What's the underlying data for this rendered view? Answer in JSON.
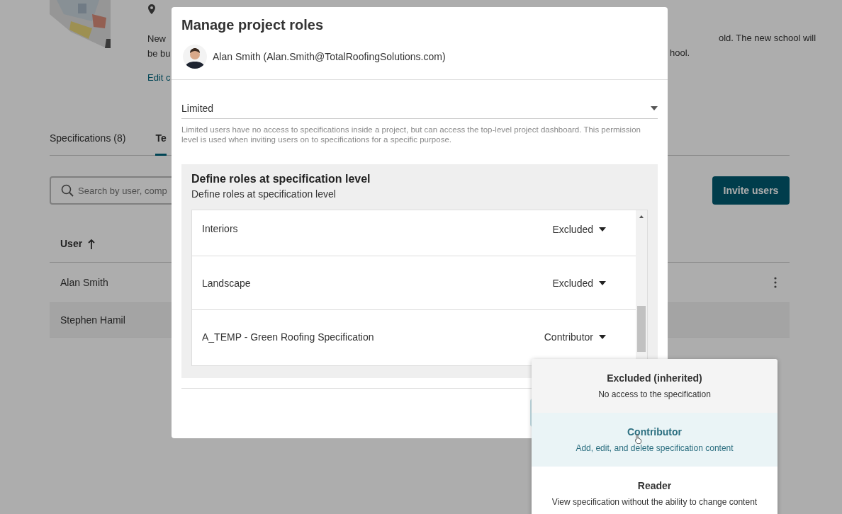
{
  "background": {
    "description_lines": [
      {
        "left": "New",
        "right": "old. The new school will"
      },
      {
        "left": "be bu",
        "right": "hool."
      }
    ],
    "edit_link": "Edit c",
    "tabs": [
      {
        "label": "Specifications (8)",
        "selected": false
      },
      {
        "label": "Te",
        "selected": true
      }
    ],
    "search": {
      "placeholder": "Search by user, comp"
    },
    "invite_button": "Invite users",
    "table": {
      "columns": [
        {
          "label": "User",
          "sorted_ascending": true
        }
      ],
      "rows": [
        {
          "user": "Alan Smith",
          "selected": false
        },
        {
          "user": "Stephen Hamil",
          "selected": true
        }
      ]
    }
  },
  "dialog": {
    "title": "Manage project roles",
    "user": "Alan Smith (Alan.Smith@TotalRoofingSolutions.com)",
    "permission": {
      "value": "Limited",
      "help": "Limited users have no access to specifications inside a project, but can access the top-level project dashboard. This permission level is used when inviting users on to specifications for a specific purpose."
    },
    "section": {
      "title": "Define roles at specification level",
      "subtitle": "Define roles at specification level",
      "specifications": [
        {
          "name": "Interiors",
          "role": "Excluded"
        },
        {
          "name": "Landscape",
          "role": "Excluded"
        },
        {
          "name": "A_TEMP - Green Roofing Specification",
          "role": "Contributor"
        }
      ]
    }
  },
  "role_menu": [
    {
      "title": "Excluded (inherited)",
      "description": "No access to the specification",
      "kind": "inherited",
      "selected": false
    },
    {
      "title": "Contributor",
      "description": "Add, edit, and delete specification content",
      "kind": "role",
      "selected": true
    },
    {
      "title": "Reader",
      "description": "View specification without the ability to change content",
      "kind": "role",
      "selected": false
    }
  ]
}
